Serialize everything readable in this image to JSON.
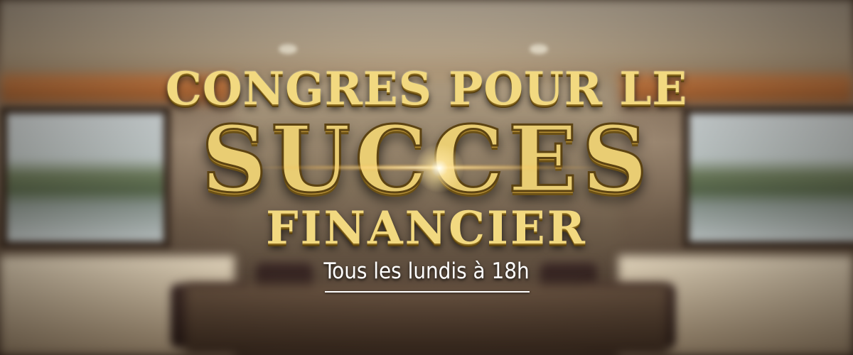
{
  "headline": {
    "line1": "CONGRES POUR LE",
    "main": "SUCCES",
    "line3": "FINANCIER"
  },
  "subtitle": "Tous les lundis à 18h",
  "colors": {
    "gold": "#f2d980",
    "gold_dark": "#5c4312",
    "subtitle": "#ffffff"
  }
}
